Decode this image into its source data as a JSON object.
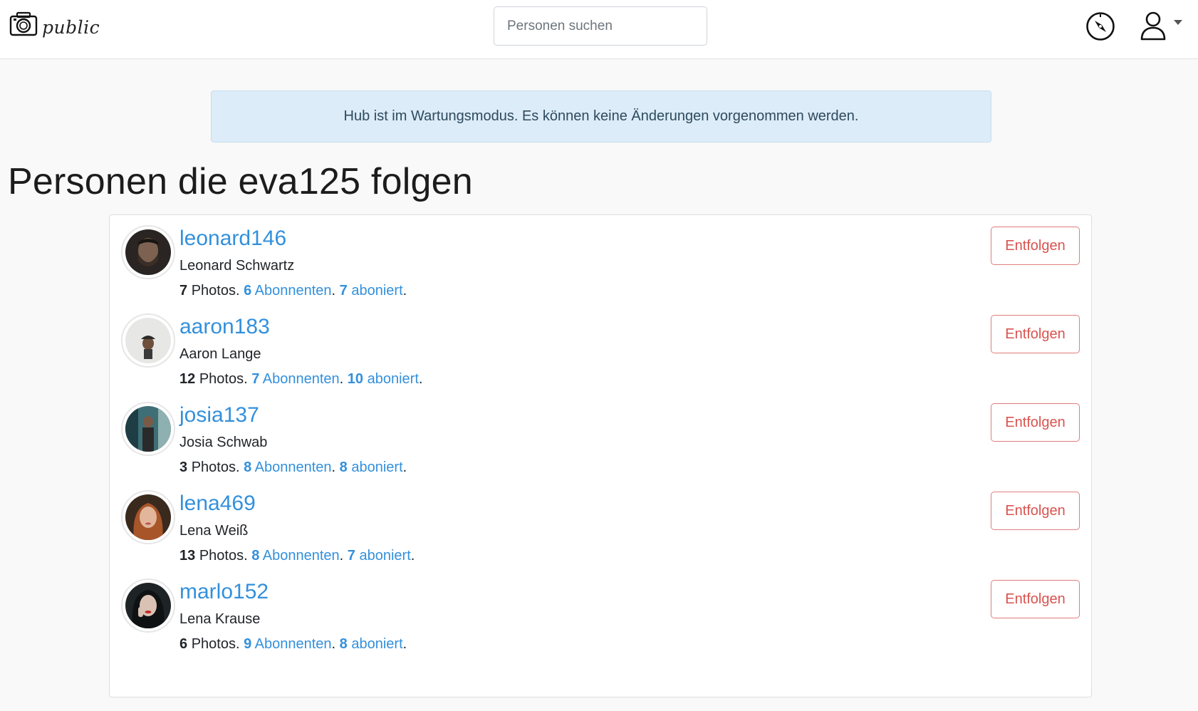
{
  "navbar": {
    "brand": "public",
    "search_placeholder": "Personen suchen",
    "explore_icon": "compass-icon",
    "account_icon": "user-icon"
  },
  "alert": {
    "text": "Hub ist im Wartungsmodus. Es können keine Änderungen vorgenommen werden."
  },
  "page": {
    "title": "Personen die eva125 folgen"
  },
  "colors": {
    "link": "#3390dc",
    "unfollow": "#d9534f",
    "alert_bg": "#dcecf8"
  },
  "users": [
    {
      "username": "leonard146",
      "name": "Leonard Schwartz",
      "photos": "7",
      "photos_label": "Photos",
      "followers": "6",
      "followers_label": "Abonnenten",
      "following": "7",
      "following_label": "aboniert",
      "button": "Entfolgen"
    },
    {
      "username": "aaron183",
      "name": "Aaron Lange",
      "photos": "12",
      "photos_label": "Photos",
      "followers": "7",
      "followers_label": "Abonnenten",
      "following": "10",
      "following_label": "aboniert",
      "button": "Entfolgen"
    },
    {
      "username": "josia137",
      "name": "Josia Schwab",
      "photos": "3",
      "photos_label": "Photos",
      "followers": "8",
      "followers_label": "Abonnenten",
      "following": "8",
      "following_label": "aboniert",
      "button": "Entfolgen"
    },
    {
      "username": "lena469",
      "name": "Lena Weiß",
      "photos": "13",
      "photos_label": "Photos",
      "followers": "8",
      "followers_label": "Abonnenten",
      "following": "7",
      "following_label": "aboniert",
      "button": "Entfolgen"
    },
    {
      "username": "marlo152",
      "name": "Lena Krause",
      "photos": "6",
      "photos_label": "Photos",
      "followers": "9",
      "followers_label": "Abonnenten",
      "following": "8",
      "following_label": "aboniert",
      "button": "Entfolgen"
    }
  ]
}
